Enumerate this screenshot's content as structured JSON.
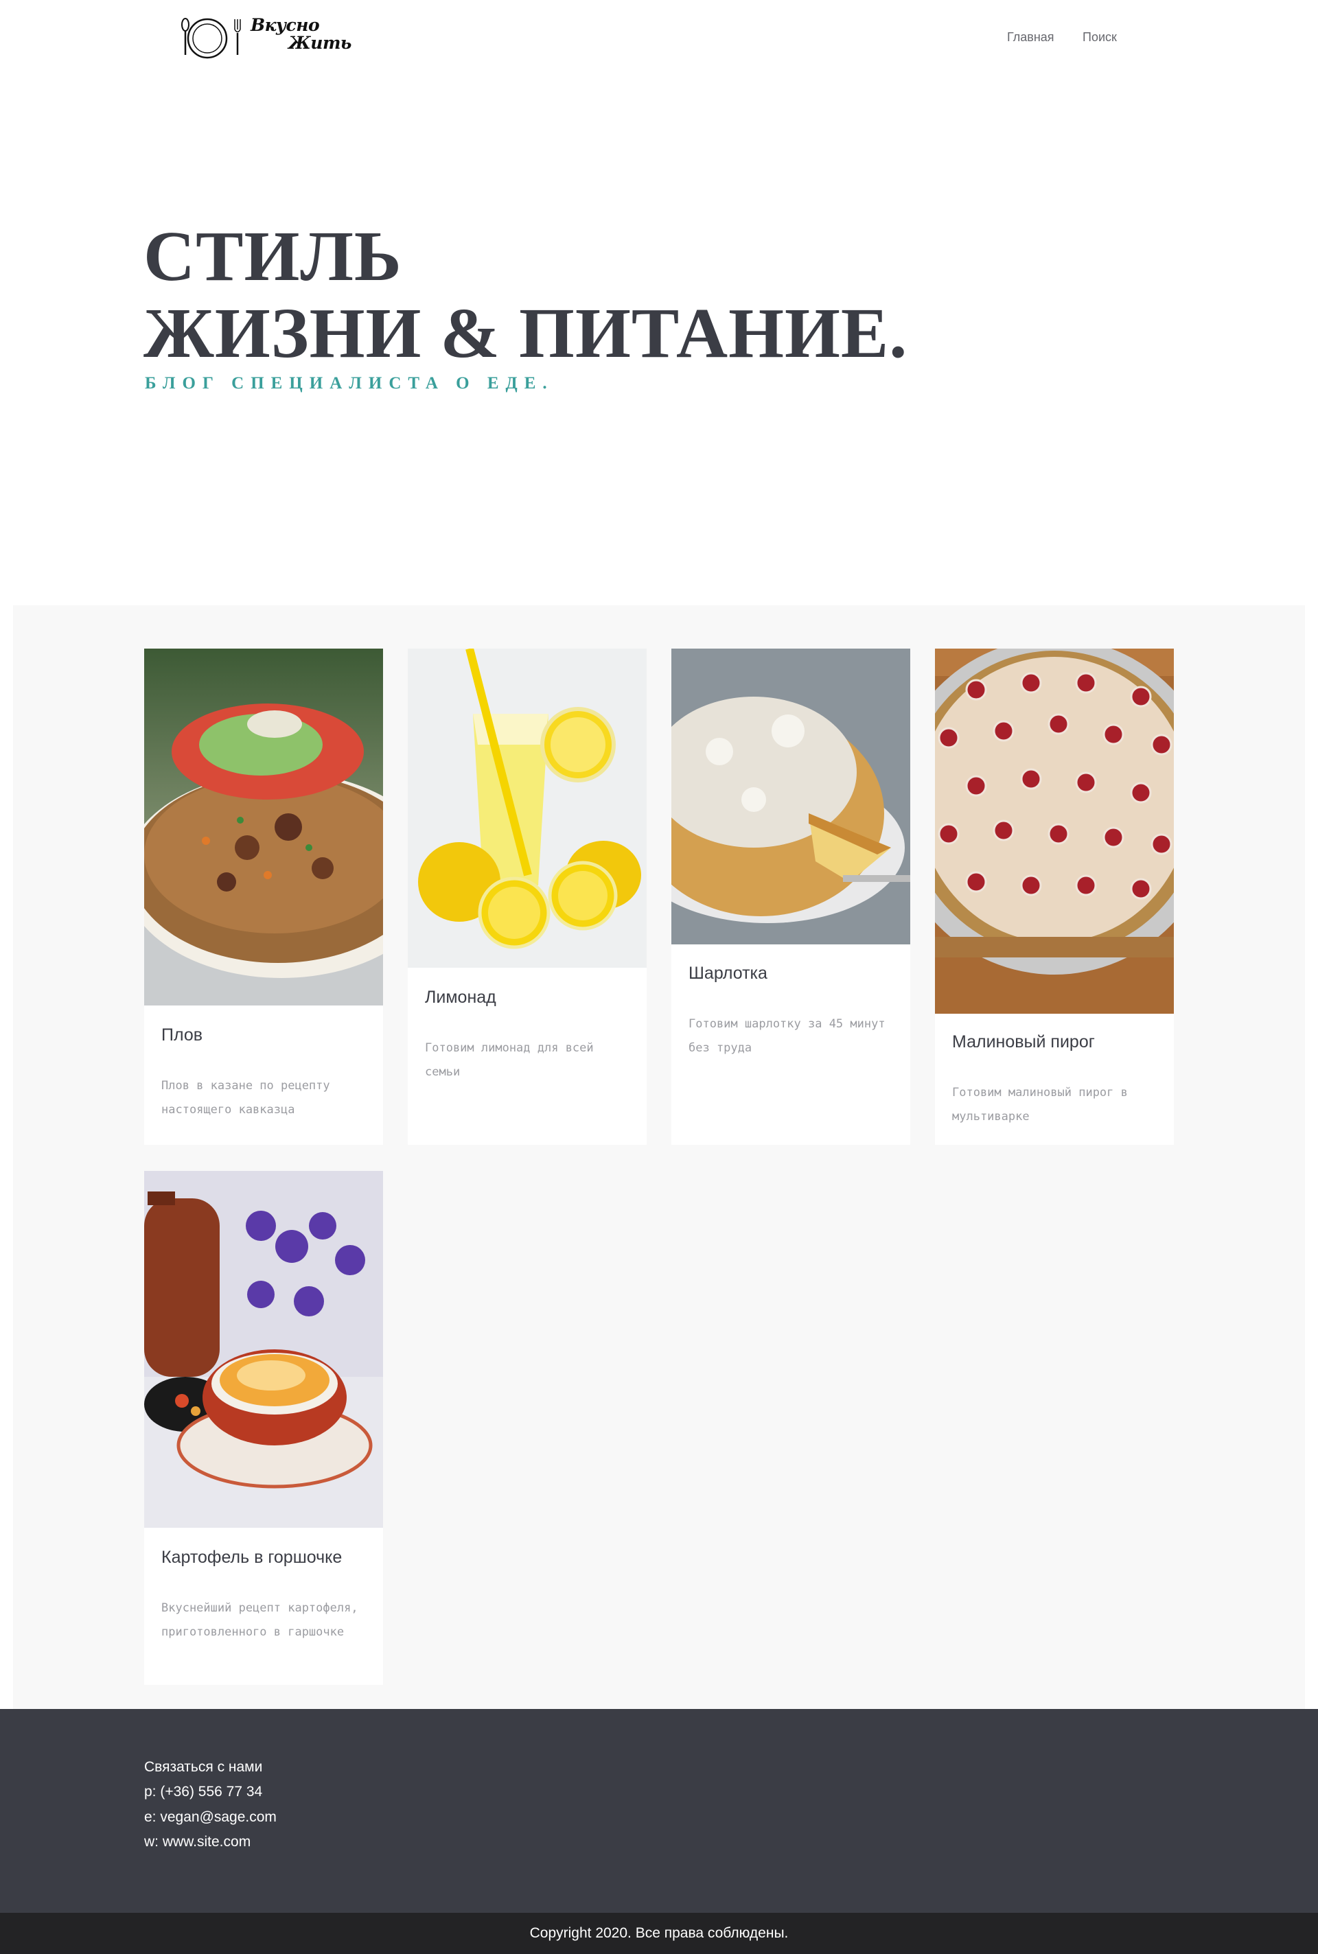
{
  "header": {
    "logo_line1": "Вкусно",
    "logo_line2": "Жить",
    "nav": [
      "Главная",
      "Поиск"
    ]
  },
  "hero": {
    "title_line1": "СТИЛЬ",
    "title_line2": "ЖИЗНИ & ПИТАНИЕ.",
    "subtitle": "БЛОГ СПЕЦИАЛИСТА О ЕДЕ."
  },
  "cards": [
    {
      "title": "Плов",
      "description": "Плов в казане по рецепту настоящего кавказца",
      "image": "plov-photo"
    },
    {
      "title": "Лимонад",
      "description": "Готовим лимонад для всей семьи",
      "image": "lemonade-photo"
    },
    {
      "title": "Шарлотка",
      "description": "Готовим шарлотку за 45 минут без труда",
      "image": "charlotte-photo"
    },
    {
      "title": "Малиновый пирог",
      "description": "Готовим малиновый пирог в мультиварке",
      "image": "raspberry-pie-photo"
    },
    {
      "title": "Картофель в горшочке",
      "description": "Вкуснейший рецепт картофеля, приготовленного в гаршочке",
      "image": "potato-pot-photo"
    }
  ],
  "footer": {
    "contact_title": "Связаться с нами",
    "phone": "p: (+36) 556 77 34",
    "email": "e: vegan@sage.com",
    "website": "w: www.site.com",
    "copyright": "Copyright 2020. Все права соблюдены."
  },
  "colors": {
    "accent": "#3a9f9b",
    "text_dark": "#3b3d45",
    "footer_bg": "#3b3d45",
    "copyright_bg": "#232325",
    "section_bg": "#f8f8f8"
  }
}
